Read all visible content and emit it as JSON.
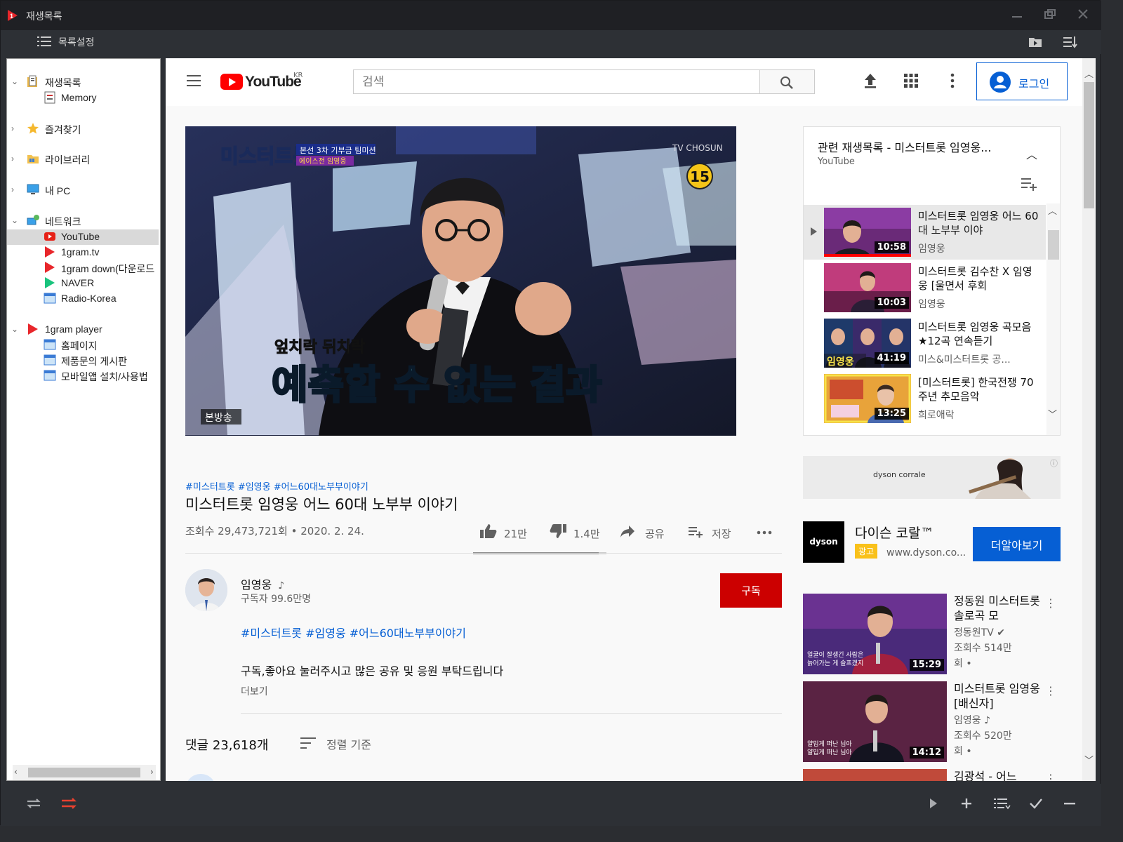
{
  "app": {
    "title": "재생목록",
    "toolbar_label": "목록설정"
  },
  "sidebar": {
    "items": [
      {
        "label": "재생목록",
        "icon": "playlist-folder-icon"
      },
      {
        "label": "Memory",
        "icon": "memory-icon"
      },
      {
        "label": "즐겨찾기",
        "icon": "star-icon"
      },
      {
        "label": "라이브러리",
        "icon": "library-folder-icon"
      },
      {
        "label": "내 PC",
        "icon": "pc-icon"
      },
      {
        "label": "네트워크",
        "icon": "network-icon"
      },
      {
        "label": "YouTube",
        "icon": "youtube-icon"
      },
      {
        "label": "1gram.tv",
        "icon": "1gram-icon"
      },
      {
        "label": "1gram down(다운로드",
        "icon": "1gram-icon"
      },
      {
        "label": "NAVER",
        "icon": "naver-icon"
      },
      {
        "label": "Radio-Korea",
        "icon": "web-icon"
      },
      {
        "label": "1gram player",
        "icon": "1gram-icon"
      },
      {
        "label": "홈페이지",
        "icon": "web-icon"
      },
      {
        "label": "제품문의 게시판",
        "icon": "web-icon"
      },
      {
        "label": "모바일앱 설치/사용법",
        "icon": "web-icon"
      }
    ]
  },
  "youtube": {
    "logo_text": "YouTube",
    "region": "KR",
    "search_placeholder": "검색",
    "login_label": "로그인",
    "video": {
      "show_tag": "미스터트롯",
      "badge_line1": "본선 3차 기부금 팀미션",
      "badge_line2": "에이스전 임영웅",
      "network": "TV CHOSUN",
      "age_rating": "15",
      "caption_small": "엎치락 뒤치락",
      "caption_big": "예측할 수 없는 결과",
      "broadcast_label": "본방송"
    },
    "hashtags": "#미스터트롯 #임영웅 #어느60대노부부이야기",
    "title": "미스터트롯 임영웅 어느 60대 노부부 이야기",
    "meta": "조회수 29,473,721회 • 2020. 2. 24.",
    "likes": "21만",
    "dislikes": "1.4만",
    "share_label": "공유",
    "save_label": "저장",
    "like_ratio": 0.94,
    "channel": {
      "name": "임영웅",
      "note": "♪",
      "subscribers": "구독자 99.6만명",
      "subscribe_label": "구독"
    },
    "description_tags": "#미스터트롯 #임영웅 #어느60대노부부이야기",
    "description": "구독,좋아요 눌러주시고 많은 공유 및 응원 부탁드립니다",
    "more_label": "더보기",
    "comments_count": "댓글 23,618개",
    "sort_label": "정렬 기준",
    "playlist": {
      "title": "관련 재생목록 - 미스터트롯 임영웅...",
      "owner": "YouTube",
      "items": [
        {
          "title": "미스터트롯 임영웅 어느 60대 노부부 이야",
          "channel": "임영웅",
          "duration": "10:58",
          "progress": 1.0
        },
        {
          "title": "미스터트롯 김수찬 X 임영웅 [울면서 후회",
          "channel": "임영웅",
          "duration": "10:03"
        },
        {
          "title": "미스터트롯 임영웅 곡모음 ★12곡 연속듣기",
          "channel": "미스&미스터트롯 공...",
          "duration": "41:19",
          "thumb_text": "임영웅"
        },
        {
          "title": "[미스터트롯] 한국전쟁 70주년 추모음악",
          "channel": "희로애락",
          "duration": "13:25"
        }
      ]
    },
    "ad": {
      "banner_brand": "dyson corrale",
      "logo": "dyson",
      "title": "다이슨 코랄™",
      "badge": "광고",
      "url": "www.dyson.co...",
      "cta": "더알아보기"
    },
    "related": [
      {
        "title": "정동원 미스터트롯 솔로곡 모",
        "channel": "정동원TV ✔",
        "views": "조회수 514만",
        "date": "회 •",
        "duration": "15:29",
        "thumb_sub": "얼굴이 잘생긴 사람은 늙어가는 게 슬프겠지"
      },
      {
        "title": "미스터트롯 임영웅 [배신자]",
        "channel": "임영웅 ♪",
        "views": "조회수 520만",
        "date": "회 •",
        "duration": "14:12",
        "thumb_sub": "얄밉게 떠난 님아 얄밉게 떠난 님아"
      },
      {
        "title": "김광석 - 어느",
        "channel": "",
        "views": "",
        "date": "",
        "duration": ""
      }
    ]
  }
}
